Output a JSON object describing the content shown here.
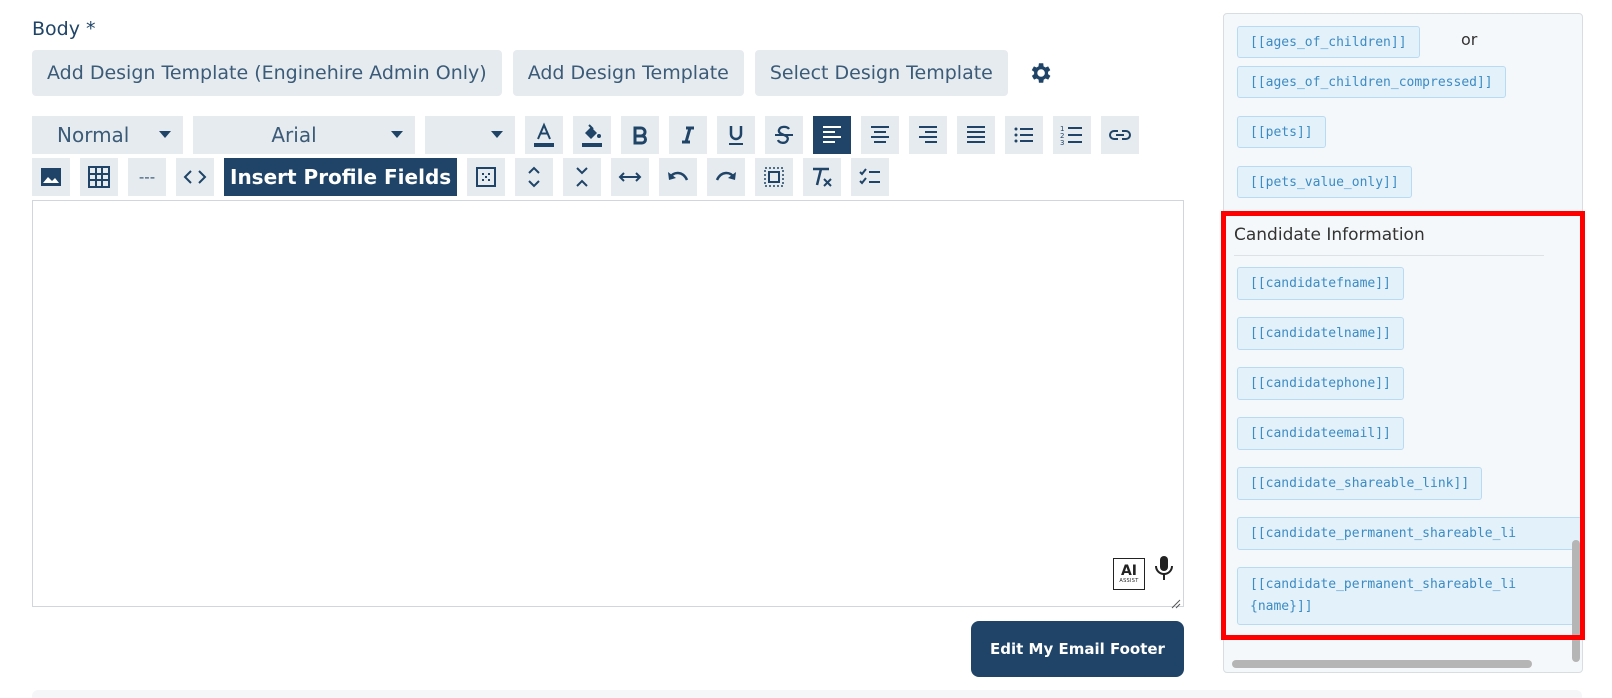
{
  "body_label": "Body *",
  "template_buttons": {
    "add_admin": "Add Design Template (Enginehire Admin Only)",
    "add": "Add Design Template",
    "select": "Select Design Template"
  },
  "toolbar": {
    "format_select": "Normal",
    "font_select": "Arial",
    "size_select": "",
    "hr_label": "---",
    "insert_profile_fields": "Insert Profile Fields"
  },
  "icons": {
    "row1": [
      "font-color-icon",
      "highlight-color-icon",
      "bold-icon",
      "italic-icon",
      "underline-icon",
      "strikethrough-icon",
      "align-left-icon",
      "align-center-icon",
      "align-right-icon",
      "align-justify-icon",
      "bullet-list-icon",
      "numbered-list-icon",
      "link-icon"
    ],
    "row2": [
      "image-icon",
      "table-icon",
      "horizontal-rule-icon",
      "code-view-icon",
      "insert-profile-fields-button",
      "show-blocks-icon",
      "expand-icon",
      "collapse-icon",
      "full-width-icon",
      "undo-icon",
      "redo-icon",
      "select-all-icon",
      "remove-format-icon",
      "checklist-icon"
    ]
  },
  "editor": {
    "ai_badge_big": "AI",
    "ai_badge_small": "ASSIST"
  },
  "footer_button": "Edit My Email Footer",
  "panel": {
    "or_text": "or",
    "top_chips": [
      "[[ages_of_children]]",
      "[[ages_of_children_compressed]]",
      "[[pets]]",
      "[[pets_value_only]]"
    ],
    "section_title": "Candidate Information",
    "candidate_chips": [
      "[[candidatefname]]",
      "[[candidatelname]]",
      "[[candidatephone]]",
      "[[candidateemail]]",
      "[[candidate_shareable_link]]",
      "[[candidate_permanent_shareable_li"
    ],
    "candidate_last_chip_line1": "[[candidate_permanent_shareable_li",
    "candidate_last_chip_line2": "{name}]]"
  },
  "colors": {
    "primary": "#1f4467",
    "chip_bg": "#e3f1fb",
    "chip_text": "#3d8bc2",
    "highlight": "#ff0000"
  }
}
